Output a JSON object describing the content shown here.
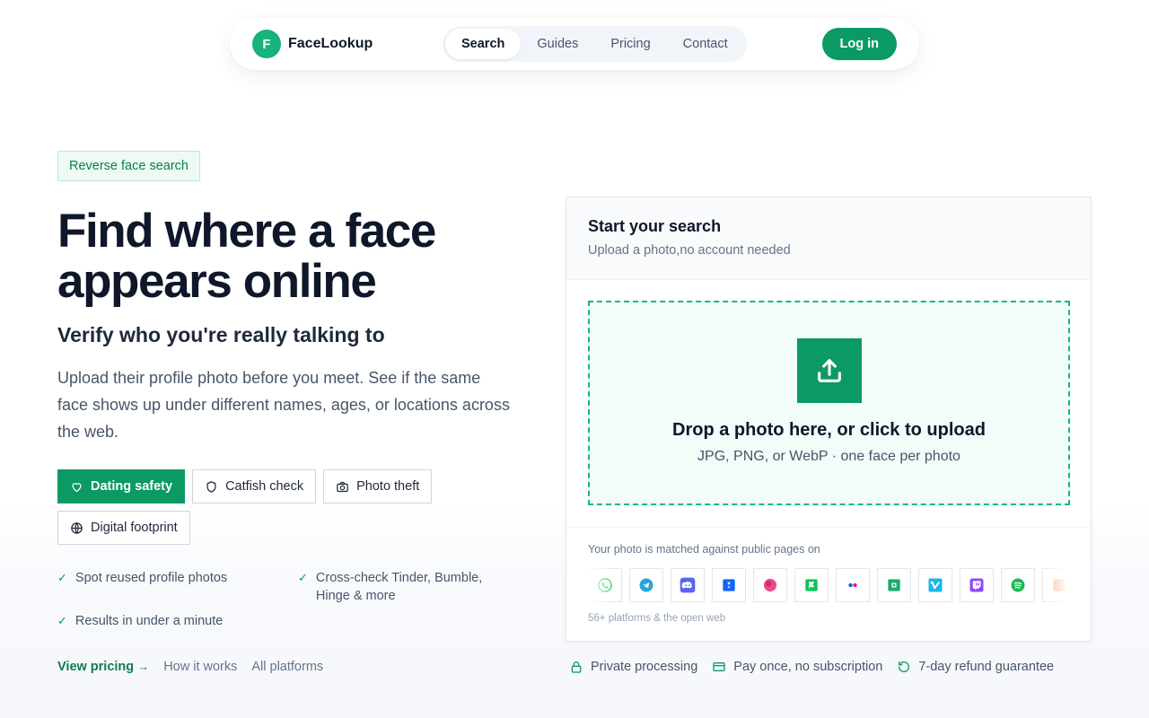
{
  "nav": {
    "brand_mark": "F",
    "brand_name": "FaceLookup",
    "links": [
      "Search",
      "Guides",
      "Pricing",
      "Contact"
    ],
    "login": "Log in"
  },
  "hero": {
    "tag": "Reverse face search",
    "headline": "Find where a face appears online",
    "subhead": "Verify who you're really talking to",
    "lede": "Upload their profile photo before you meet. See if the same face shows up under different names, ages, or locations across the web.",
    "chips": [
      "Dating safety",
      "Catfish check",
      "Photo theft",
      "Digital footprint"
    ],
    "benefits": [
      "Spot reused profile photos",
      "Cross-check Tinder, Bumble, Hinge & more",
      "Results in under a minute"
    ],
    "links": {
      "view_pricing": "View pricing",
      "arrow": "→",
      "how_it_works": "How it works",
      "all_platforms": "All platforms"
    }
  },
  "card": {
    "title": "Start your search",
    "subtitle": "Upload a photo,no account needed",
    "drop_title": "Drop a photo here, or click to upload",
    "drop_sub": "JPG, PNG, or WebP · one face per photo",
    "matched_label": "Your photo is matched against public pages on",
    "platform_icons": [
      "whatsapp-icon",
      "telegram-icon",
      "discord-icon",
      "bluesky-icon",
      "dribbble-icon",
      "line-icon",
      "flickr-icon",
      "wechat-icon",
      "vimeo-icon",
      "twitch-icon",
      "spotify-icon",
      "partial-icon"
    ],
    "platform_count": "56+ platforms & the open web"
  },
  "trust": [
    "Private processing",
    "Pay once, no subscription",
    "7-day refund guarantee"
  ],
  "colors": {
    "accent": "#0b9a63",
    "brand": "#16b37a",
    "tag_bg": "#edfbf3"
  }
}
